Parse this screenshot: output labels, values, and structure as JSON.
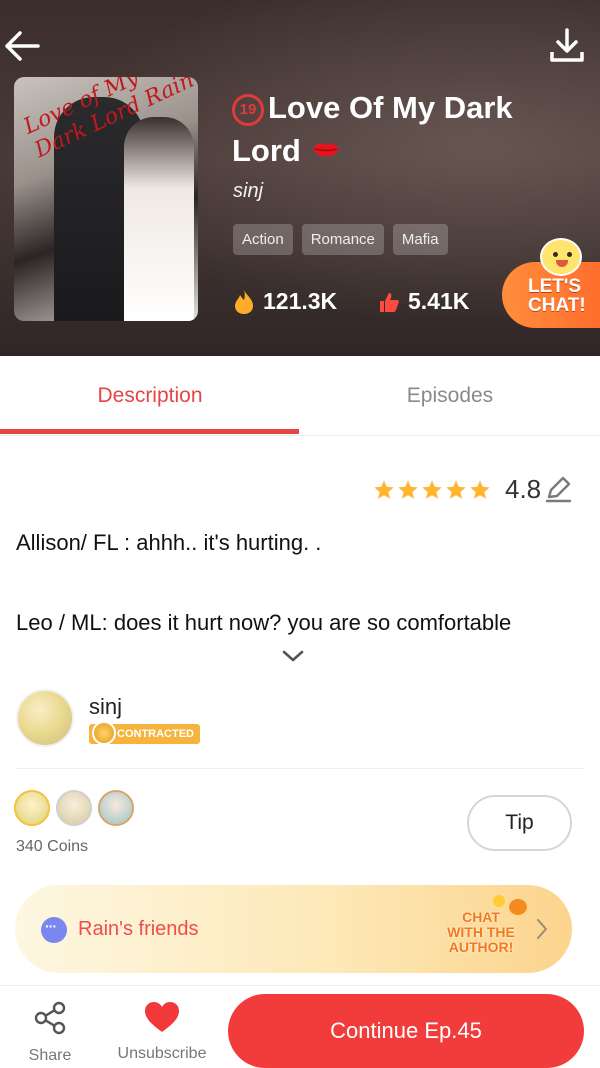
{
  "header": {
    "age_rating": "19",
    "title": "Love Of My Dark Lord",
    "author": "sinj",
    "tags": [
      "Action",
      "Romance",
      "Mafia"
    ],
    "views": "121.3K",
    "likes": "5.41K",
    "chat_cta": [
      "LET'S",
      "CHAT!"
    ],
    "cover_script": "Love of My Dark Lord Rain"
  },
  "tabs": {
    "description": "Description",
    "episodes": "Episodes",
    "active": "Description"
  },
  "rating": {
    "value": "4.8",
    "stars": 5
  },
  "description": {
    "line1": "Allison/ FL : ahhh.. it's  hurting. .",
    "line2": "Leo / ML: does it hurt now? you are so comfortable"
  },
  "author_block": {
    "name": "sinj",
    "badge": "CONTRACTED"
  },
  "supporters": {
    "coins": "340 Coins",
    "tip_label": "Tip"
  },
  "friends_banner": {
    "label": "Rain's friends",
    "cta": [
      "CHAT",
      "WITH THE",
      "AUTHOR!"
    ]
  },
  "bottom_bar": {
    "share": "Share",
    "unsubscribe": "Unsubscribe",
    "continue": "Continue Ep.45"
  },
  "colors": {
    "accent": "#e64545",
    "cta_orange": "#ff7a2e",
    "tag_bg": "rgba(255,255,255,0.22)"
  },
  "icons": [
    "back-arrow-icon",
    "download-icon",
    "fire-icon",
    "thumbs-up-icon",
    "star-icon",
    "edit-pencil-icon",
    "chevron-down-icon",
    "share-icon",
    "heart-icon",
    "chevron-right-icon",
    "chat-bubble-icon"
  ]
}
